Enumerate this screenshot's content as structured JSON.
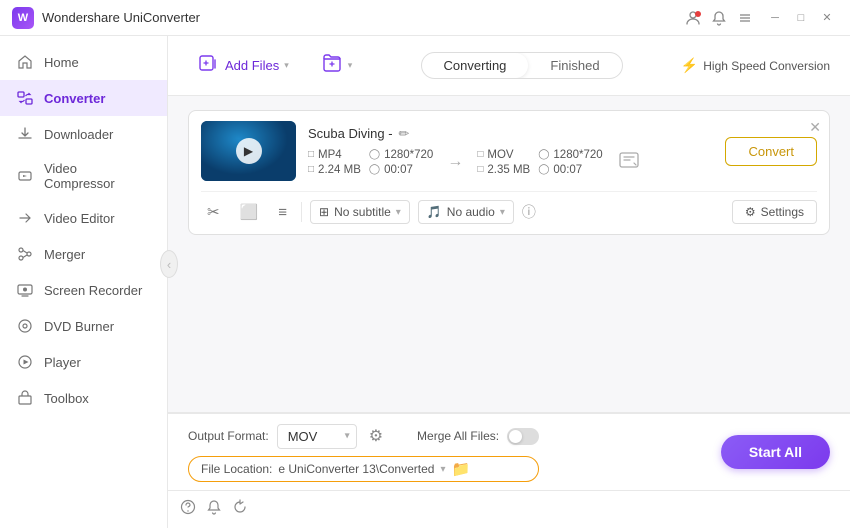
{
  "titlebar": {
    "logo_text": "W",
    "title": "Wondershare UniConverter",
    "icons": [
      "user-icon",
      "bell-icon",
      "menu-icon"
    ],
    "controls": [
      "minimize",
      "maximize",
      "close"
    ]
  },
  "sidebar": {
    "items": [
      {
        "id": "home",
        "label": "Home",
        "icon": "🏠",
        "active": false
      },
      {
        "id": "converter",
        "label": "Converter",
        "icon": "⚡",
        "active": true
      },
      {
        "id": "downloader",
        "label": "Downloader",
        "icon": "⬇",
        "active": false
      },
      {
        "id": "video-compressor",
        "label": "Video Compressor",
        "icon": "🗜",
        "active": false
      },
      {
        "id": "video-editor",
        "label": "Video Editor",
        "icon": "✂",
        "active": false
      },
      {
        "id": "merger",
        "label": "Merger",
        "icon": "🔀",
        "active": false
      },
      {
        "id": "screen-recorder",
        "label": "Screen Recorder",
        "icon": "⏺",
        "active": false
      },
      {
        "id": "dvd-burner",
        "label": "DVD Burner",
        "icon": "💿",
        "active": false
      },
      {
        "id": "player",
        "label": "Player",
        "icon": "▶",
        "active": false
      },
      {
        "id": "toolbox",
        "label": "Toolbox",
        "icon": "🧰",
        "active": false
      }
    ]
  },
  "toolbar": {
    "add_files_label": "Add Files",
    "add_folder_label": "Add",
    "tab_converting": "Converting",
    "tab_finished": "Finished",
    "high_speed_label": "High Speed Conversion"
  },
  "file_card": {
    "title": "Scuba Diving -",
    "source_format": "MP4",
    "source_resolution": "1280*720",
    "source_size": "2.24 MB",
    "source_duration": "00:07",
    "target_format": "MOV",
    "target_resolution": "1280*720",
    "target_size": "2.35 MB",
    "target_duration": "00:07",
    "subtitle_label": "No subtitle",
    "audio_label": "No audio",
    "settings_label": "Settings",
    "convert_btn_label": "Convert"
  },
  "bottom_bar": {
    "output_format_label": "Output Format:",
    "output_format_value": "MOV",
    "merge_files_label": "Merge All Files:",
    "file_location_label": "File Location:",
    "file_location_path": "e UniConverter 13\\Converted",
    "start_all_label": "Start All"
  },
  "bottom_icons": [
    "help-icon",
    "notification-icon",
    "refresh-icon"
  ]
}
